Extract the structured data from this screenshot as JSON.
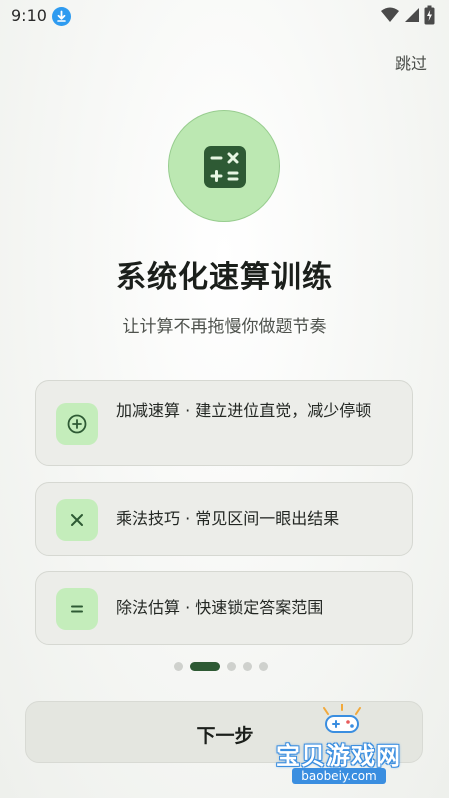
{
  "status_bar": {
    "time": "9:10",
    "icons": [
      "download-notification-icon",
      "wifi-icon",
      "signal-icon",
      "battery-icon"
    ]
  },
  "skip_label": "跳过",
  "hero": {
    "icon": "calculator-icon"
  },
  "title": "系统化速算训练",
  "subtitle": "让计算不再拖慢你做题节奏",
  "features": [
    {
      "icon": "plus-circle-icon",
      "text": "加减速算 · 建立进位直觉，减少停顿"
    },
    {
      "icon": "multiply-icon",
      "text": "乘法技巧 · 常见区间一眼出结果"
    },
    {
      "icon": "equals-icon",
      "text": "除法估算 · 快速锁定答案范围"
    }
  ],
  "pager": {
    "total": 5,
    "current": 2
  },
  "next_label": "下一步",
  "watermark": {
    "name": "宝贝游戏网",
    "url": "baobeiy.com"
  },
  "colors": {
    "accent_dark": "#2e5a34",
    "accent_light": "#c4edbb",
    "hero_fill": "#bce8b2",
    "card_bg": "#ecede9",
    "download_badge": "#2e9bf0"
  }
}
